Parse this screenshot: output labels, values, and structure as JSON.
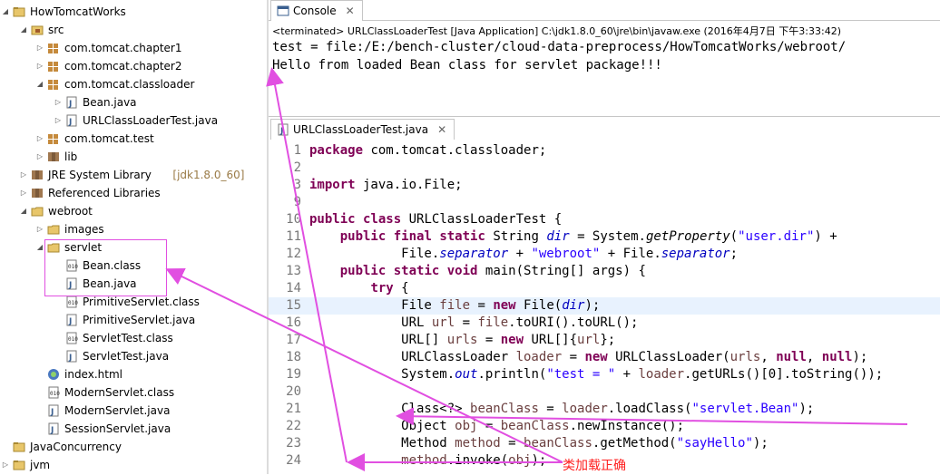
{
  "explorer": {
    "items": [
      {
        "label": "HowTomcatWorks",
        "icon": "project-icon",
        "twisty": "open",
        "extra": ""
      },
      {
        "label": "src",
        "icon": "source-folder-icon",
        "twisty": "open",
        "extra": ""
      },
      {
        "label": "com.tomcat.chapter1",
        "icon": "package-icon",
        "twisty": "closed",
        "extra": ""
      },
      {
        "label": "com.tomcat.chapter2",
        "icon": "package-icon",
        "twisty": "closed",
        "extra": ""
      },
      {
        "label": "com.tomcat.classloader",
        "icon": "package-icon",
        "twisty": "open",
        "extra": ""
      },
      {
        "label": "Bean.java",
        "icon": "java-file-icon",
        "twisty": "closed",
        "extra": ""
      },
      {
        "label": "URLClassLoaderTest.java",
        "icon": "java-file-icon",
        "twisty": "closed",
        "extra": ""
      },
      {
        "label": "com.tomcat.test",
        "icon": "package-icon",
        "twisty": "closed",
        "extra": ""
      },
      {
        "label": "lib",
        "icon": "library-icon",
        "twisty": "closed",
        "extra": ""
      },
      {
        "label": "JRE System Library",
        "icon": "library-icon",
        "twisty": "closed",
        "extra": "[jdk1.8.0_60]"
      },
      {
        "label": "Referenced Libraries",
        "icon": "library-icon",
        "twisty": "closed",
        "extra": ""
      },
      {
        "label": "webroot",
        "icon": "folder-icon",
        "twisty": "open",
        "extra": ""
      },
      {
        "label": "images",
        "icon": "folder-icon",
        "twisty": "closed",
        "extra": ""
      },
      {
        "label": "servlet",
        "icon": "folder-icon",
        "twisty": "open",
        "extra": ""
      },
      {
        "label": "Bean.class",
        "icon": "class-file-icon",
        "twisty": "none",
        "extra": ""
      },
      {
        "label": "Bean.java",
        "icon": "java-file-icon",
        "twisty": "none",
        "extra": ""
      },
      {
        "label": "PrimitiveServlet.class",
        "icon": "class-file-icon",
        "twisty": "none",
        "extra": ""
      },
      {
        "label": "PrimitiveServlet.java",
        "icon": "java-file-icon",
        "twisty": "none",
        "extra": ""
      },
      {
        "label": "ServletTest.class",
        "icon": "class-file-icon",
        "twisty": "none",
        "extra": ""
      },
      {
        "label": "ServletTest.java",
        "icon": "java-file-icon",
        "twisty": "none",
        "extra": ""
      },
      {
        "label": "index.html",
        "icon": "html-file-icon",
        "twisty": "none",
        "extra": ""
      },
      {
        "label": "ModernServlet.class",
        "icon": "class-file-icon",
        "twisty": "none",
        "extra": ""
      },
      {
        "label": "ModernServlet.java",
        "icon": "java-file-icon",
        "twisty": "none",
        "extra": ""
      },
      {
        "label": "SessionServlet.java",
        "icon": "java-file-icon",
        "twisty": "none",
        "extra": ""
      },
      {
        "label": "JavaConcurrency",
        "icon": "project-icon",
        "twisty": "none",
        "extra": ""
      },
      {
        "label": "jvm",
        "icon": "project-icon",
        "twisty": "closed",
        "extra": ""
      }
    ]
  },
  "console": {
    "tab_label": "Console",
    "status": "<terminated> URLClassLoaderTest [Java Application] C:\\jdk1.8.0_60\\jre\\bin\\javaw.exe (2016年4月7日 下午3:33:42)",
    "output": [
      "test = file:/E:/bench-cluster/cloud-data-preprocess/HowTomcatWorks/webroot/",
      "Hello from loaded Bean class for servlet package!!!"
    ]
  },
  "editor": {
    "tab_label": "URLClassLoaderTest.java",
    "line_numbers": [
      "1",
      "2",
      "3",
      "9",
      "10",
      "11",
      "12",
      "13",
      "14",
      "15",
      "16",
      "17",
      "18",
      "19",
      "20",
      "21",
      "22",
      "23",
      "24"
    ],
    "lines": [
      [
        {
          "t": "package",
          "c": "kw"
        },
        {
          "t": " com.tomcat.classloader;",
          "c": ""
        }
      ],
      [],
      [
        {
          "t": "import",
          "c": "kw"
        },
        {
          "t": " java.io.File;",
          "c": ""
        }
      ],
      [],
      [
        {
          "t": "public",
          "c": "kw"
        },
        {
          "t": " ",
          "c": ""
        },
        {
          "t": "class",
          "c": "kw"
        },
        {
          "t": " URLClassLoaderTest {",
          "c": ""
        }
      ],
      [
        {
          "t": "    ",
          "c": ""
        },
        {
          "t": "public",
          "c": "kw"
        },
        {
          "t": " ",
          "c": ""
        },
        {
          "t": "final",
          "c": "kw"
        },
        {
          "t": " ",
          "c": ""
        },
        {
          "t": "static",
          "c": "kw"
        },
        {
          "t": " String ",
          "c": ""
        },
        {
          "t": "dir",
          "c": "fld"
        },
        {
          "t": " = System.",
          "c": ""
        },
        {
          "t": "getProperty",
          "c": "mth"
        },
        {
          "t": "(",
          "c": ""
        },
        {
          "t": "\"user.dir\"",
          "c": "str"
        },
        {
          "t": ") +",
          "c": ""
        }
      ],
      [
        {
          "t": "            File.",
          "c": ""
        },
        {
          "t": "separator",
          "c": "fld"
        },
        {
          "t": " + ",
          "c": ""
        },
        {
          "t": "\"webroot\"",
          "c": "str"
        },
        {
          "t": " + File.",
          "c": ""
        },
        {
          "t": "separator",
          "c": "fld"
        },
        {
          "t": ";",
          "c": ""
        }
      ],
      [
        {
          "t": "    ",
          "c": ""
        },
        {
          "t": "public",
          "c": "kw"
        },
        {
          "t": " ",
          "c": ""
        },
        {
          "t": "static",
          "c": "kw"
        },
        {
          "t": " ",
          "c": ""
        },
        {
          "t": "void",
          "c": "kw"
        },
        {
          "t": " main(String[] args) {",
          "c": ""
        }
      ],
      [
        {
          "t": "        ",
          "c": ""
        },
        {
          "t": "try",
          "c": "kw"
        },
        {
          "t": " {",
          "c": ""
        }
      ],
      [
        {
          "t": "            File ",
          "c": ""
        },
        {
          "t": "file",
          "c": "var"
        },
        {
          "t": " = ",
          "c": ""
        },
        {
          "t": "new",
          "c": "kw"
        },
        {
          "t": " File(",
          "c": ""
        },
        {
          "t": "dir",
          "c": "fld"
        },
        {
          "t": ");",
          "c": ""
        }
      ],
      [
        {
          "t": "            URL ",
          "c": ""
        },
        {
          "t": "url",
          "c": "var"
        },
        {
          "t": " = ",
          "c": ""
        },
        {
          "t": "file",
          "c": "var"
        },
        {
          "t": ".toURI().toURL();",
          "c": ""
        }
      ],
      [
        {
          "t": "            URL[] ",
          "c": ""
        },
        {
          "t": "urls",
          "c": "var"
        },
        {
          "t": " = ",
          "c": ""
        },
        {
          "t": "new",
          "c": "kw"
        },
        {
          "t": " URL[]{",
          "c": ""
        },
        {
          "t": "url",
          "c": "var"
        },
        {
          "t": "};",
          "c": ""
        }
      ],
      [
        {
          "t": "            URLClassLoader ",
          "c": ""
        },
        {
          "t": "loader",
          "c": "var"
        },
        {
          "t": " = ",
          "c": ""
        },
        {
          "t": "new",
          "c": "kw"
        },
        {
          "t": " URLClassLoader(",
          "c": ""
        },
        {
          "t": "urls",
          "c": "var"
        },
        {
          "t": ", ",
          "c": ""
        },
        {
          "t": "null",
          "c": "kw"
        },
        {
          "t": ", ",
          "c": ""
        },
        {
          "t": "null",
          "c": "kw"
        },
        {
          "t": ");",
          "c": ""
        }
      ],
      [
        {
          "t": "            System.",
          "c": ""
        },
        {
          "t": "out",
          "c": "fld"
        },
        {
          "t": ".println(",
          "c": ""
        },
        {
          "t": "\"test = \"",
          "c": "str"
        },
        {
          "t": " + ",
          "c": ""
        },
        {
          "t": "loader",
          "c": "var"
        },
        {
          "t": ".getURLs()[0].toString());",
          "c": ""
        }
      ],
      [],
      [
        {
          "t": "            Class<?> ",
          "c": ""
        },
        {
          "t": "beanClass",
          "c": "var"
        },
        {
          "t": " = ",
          "c": ""
        },
        {
          "t": "loader",
          "c": "var"
        },
        {
          "t": ".loadClass(",
          "c": ""
        },
        {
          "t": "\"servlet.Bean\"",
          "c": "str"
        },
        {
          "t": ");",
          "c": ""
        }
      ],
      [
        {
          "t": "            Object ",
          "c": ""
        },
        {
          "t": "obj",
          "c": "var"
        },
        {
          "t": " = ",
          "c": ""
        },
        {
          "t": "beanClass",
          "c": "var"
        },
        {
          "t": ".newInstance();",
          "c": ""
        }
      ],
      [
        {
          "t": "            Method ",
          "c": ""
        },
        {
          "t": "method",
          "c": "var"
        },
        {
          "t": " = ",
          "c": ""
        },
        {
          "t": "beanClass",
          "c": "var"
        },
        {
          "t": ".getMethod(",
          "c": ""
        },
        {
          "t": "\"sayHello\"",
          "c": "str"
        },
        {
          "t": ");",
          "c": ""
        }
      ],
      [
        {
          "t": "            ",
          "c": ""
        },
        {
          "t": "method",
          "c": "var"
        },
        {
          "t": ".invoke(",
          "c": ""
        },
        {
          "t": "obj",
          "c": "var"
        },
        {
          "t": ");",
          "c": ""
        }
      ]
    ]
  },
  "annotation": "类加载正确",
  "colors": {
    "keyword": "#7f0055",
    "string": "#2a00ff",
    "field": "#0000c0",
    "arrow": "#e14fe1",
    "annotation": "#ff2020"
  }
}
